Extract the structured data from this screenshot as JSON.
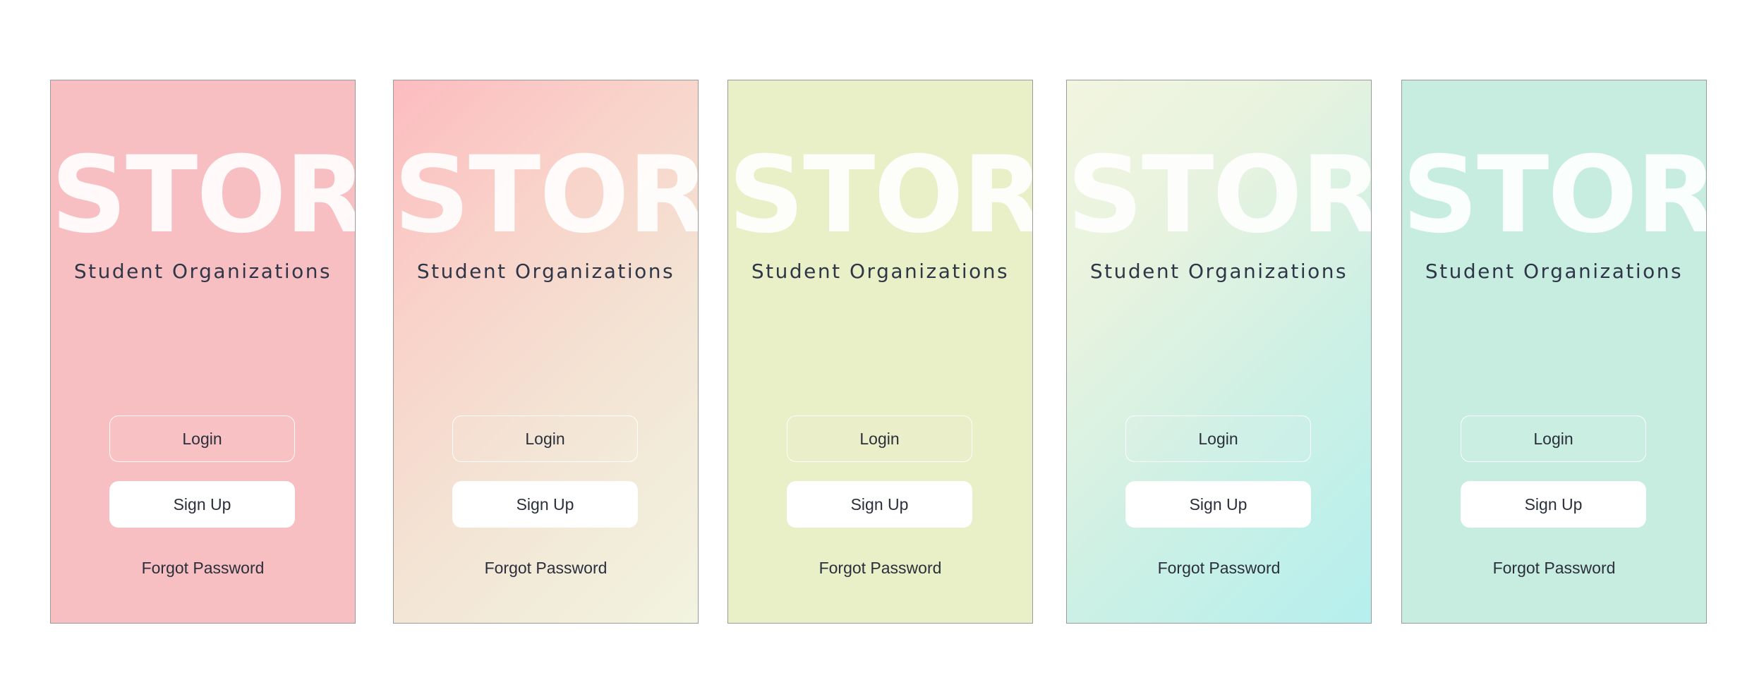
{
  "screens": [
    {
      "variant": "pink",
      "logo": "STOR",
      "subtitle": "Student Organizations",
      "login_label": "Login",
      "signup_label": "Sign Up",
      "forgot_label": "Forgot Password",
      "background": "#f8bfc2"
    },
    {
      "variant": "pink-to-cream-gradient",
      "logo": "STOR",
      "subtitle": "Student Organizations",
      "login_label": "Login",
      "signup_label": "Sign Up",
      "forgot_label": "Forgot Password",
      "background": "#fcbcc0 to #f2f4e0"
    },
    {
      "variant": "lime",
      "logo": "STOR",
      "subtitle": "Student Organizations",
      "login_label": "Login",
      "signup_label": "Sign Up",
      "forgot_label": "Forgot Password",
      "background": "#e9efc6"
    },
    {
      "variant": "cream-to-aqua-gradient",
      "logo": "STOR",
      "subtitle": "Student Organizations",
      "login_label": "Login",
      "signup_label": "Sign Up",
      "forgot_label": "Forgot Password",
      "background": "#f2f5df to #b5efee"
    },
    {
      "variant": "mint",
      "logo": "STOR",
      "subtitle": "Student Organizations",
      "login_label": "Login",
      "signup_label": "Sign Up",
      "forgot_label": "Forgot Password",
      "background": "#c7ede0"
    }
  ],
  "colors": {
    "text": "#2a2f3b",
    "subtitle": "#2e3648",
    "logo": "#ffffff",
    "signup_button": "#ffffff",
    "card_border": "#9a9a9a"
  }
}
